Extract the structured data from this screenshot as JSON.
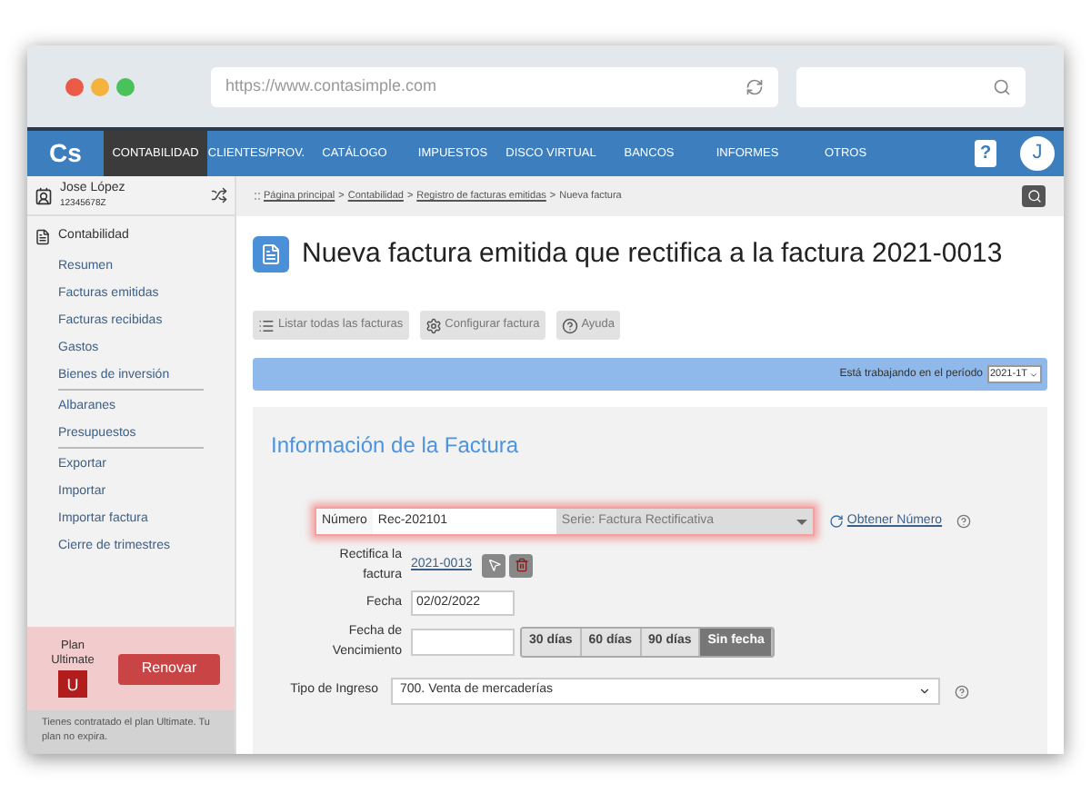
{
  "browser": {
    "url": "https://www.contasimple.com"
  },
  "nav": {
    "logo": "Cs",
    "items": [
      {
        "label": "CONTABILIDAD",
        "selected": true
      },
      {
        "label": "CLIENTES/PROV.",
        "selected": false
      },
      {
        "label": "CATÁLOGO",
        "selected": false
      },
      {
        "label": "IMPUESTOS",
        "selected": false
      },
      {
        "label": "DISCO VIRTUAL",
        "selected": false
      },
      {
        "label": "BANCOS",
        "selected": false
      },
      {
        "label": "INFORMES",
        "selected": false
      },
      {
        "label": "OTROS",
        "selected": false
      }
    ],
    "help": "?",
    "avatar": "J"
  },
  "user": {
    "name": "Jose López",
    "id": "12345678Z"
  },
  "breadcrumbs": {
    "separator": ">",
    "items": [
      "Página principal",
      "Contabilidad",
      "Registro de facturas emitidas",
      "Nueva factura"
    ]
  },
  "sidebar": {
    "section": "Contabilidad",
    "groups": [
      [
        "Resumen",
        "Facturas emitidas",
        "Facturas recibidas",
        "Gastos",
        "Bienes de inversión"
      ],
      [
        "Albaranes",
        "Presupuestos"
      ],
      [
        "Exportar",
        "Importar",
        "Importar factura",
        "Cierre de trimestres"
      ]
    ]
  },
  "plan": {
    "label": "Plan",
    "name": "Ultimate",
    "badge": "U",
    "button": "Renovar",
    "note": "Tienes contratado el plan Ultimate. Tu plan no expira."
  },
  "page_title": "Nueva factura emitida que rectifica a la factura 2021-0013",
  "toolbar": [
    {
      "label": "Listar todas las facturas",
      "kind": "list"
    },
    {
      "label": "Configurar factura",
      "kind": "gear"
    },
    {
      "label": "Ayuda",
      "kind": "help"
    }
  ],
  "period": {
    "label": "Está trabajando en el período",
    "value": "2021-1T"
  },
  "form": {
    "title": "Información de la Factura",
    "numero": {
      "label": "Número",
      "value": "Rec-202101",
      "serie": "Serie: Factura Rectificativa",
      "link": "Obtener Número"
    },
    "rectifica": {
      "label": "Rectifica la factura",
      "link": "2021-0013"
    },
    "fecha": {
      "label": "Fecha",
      "value": "02/02/2022"
    },
    "vencimiento": {
      "label": "Fecha de Vencimiento",
      "options": [
        {
          "label": "30 días",
          "selected": false
        },
        {
          "label": "60 días",
          "selected": false
        },
        {
          "label": "90 días",
          "selected": false
        },
        {
          "label": "Sin fecha",
          "selected": true
        }
      ]
    },
    "tipo": {
      "label": "Tipo de Ingreso",
      "value": "700. Venta de mercaderías"
    }
  }
}
